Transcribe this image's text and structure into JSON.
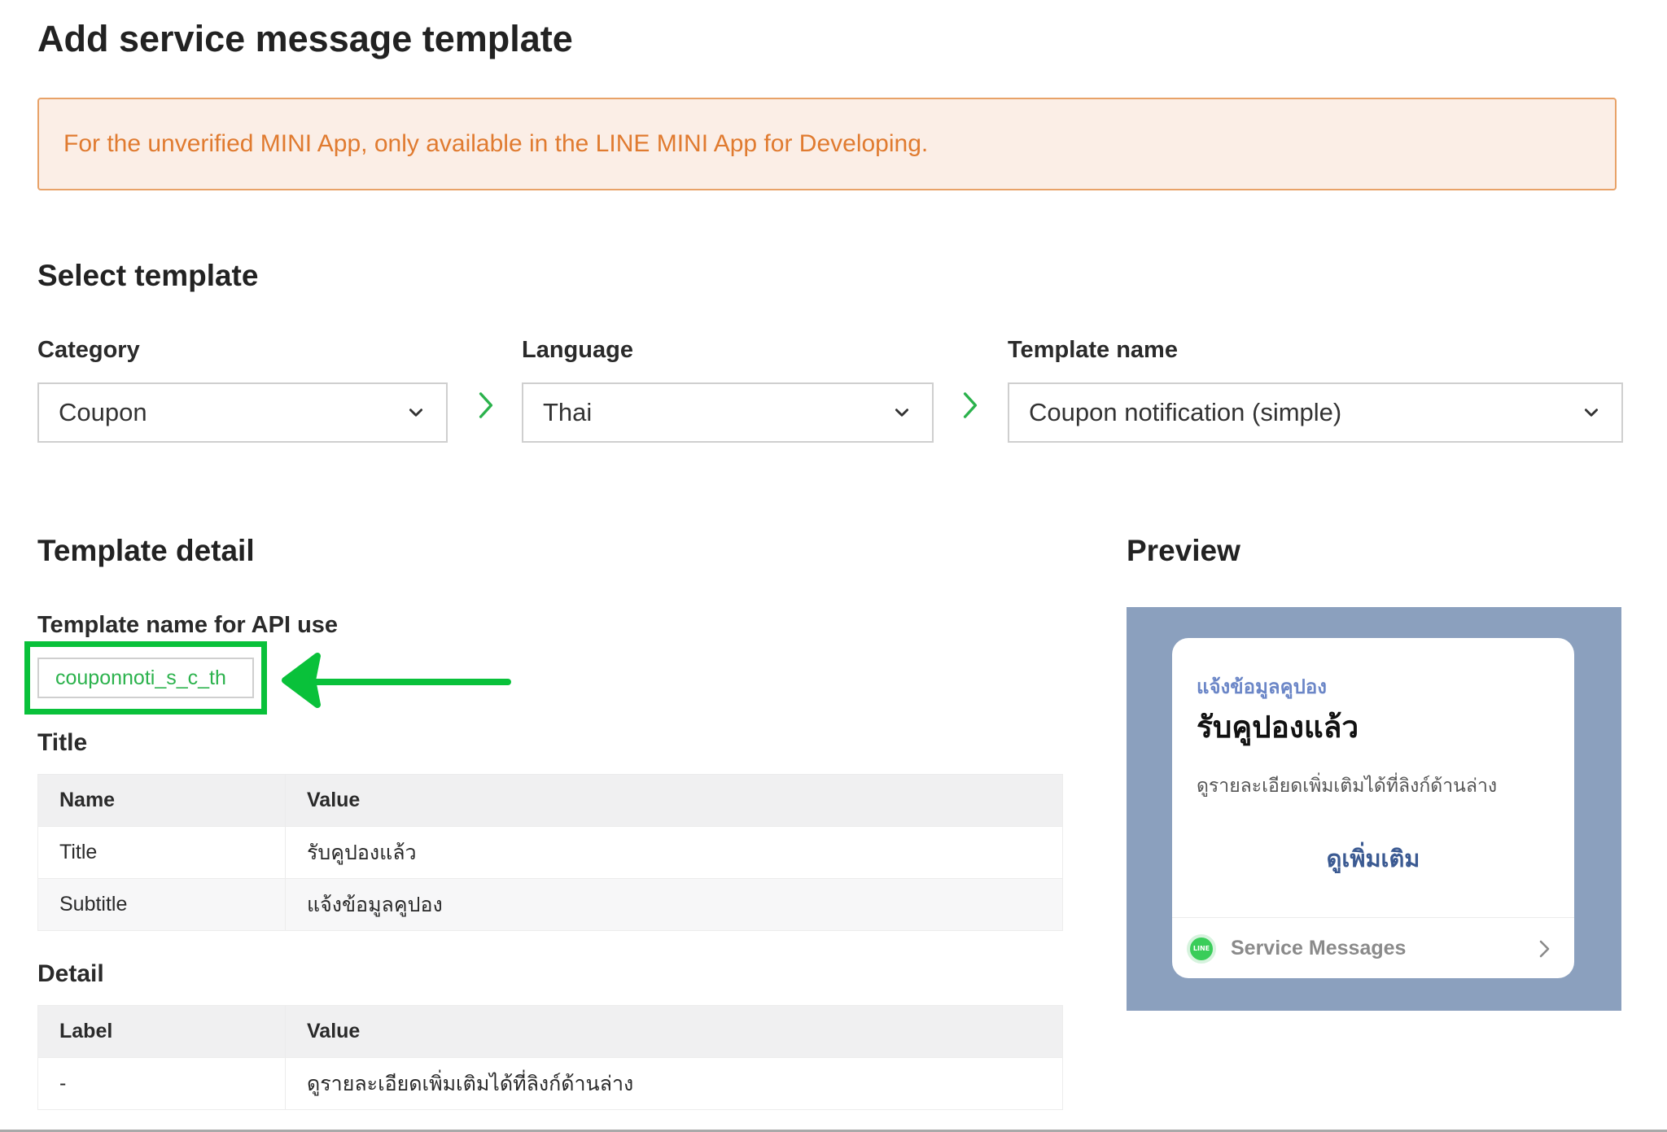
{
  "page": {
    "title": "Add service message template"
  },
  "alert": {
    "text": "For the unverified MINI App, only available in the LINE MINI App for Developing."
  },
  "select_template": {
    "heading": "Select template",
    "category": {
      "label": "Category",
      "value": "Coupon"
    },
    "language": {
      "label": "Language",
      "value": "Thai"
    },
    "template_name": {
      "label": "Template name",
      "value": "Coupon notification (simple)"
    }
  },
  "template_detail": {
    "heading": "Template detail",
    "api_name_label": "Template name for API use",
    "api_name_value": "couponnoti_s_c_th",
    "title_section": {
      "heading": "Title",
      "columns": [
        "Name",
        "Value"
      ],
      "rows": [
        [
          "Title",
          "รับคูปองแล้ว"
        ],
        [
          "Subtitle",
          "แจ้งข้อมูลคูปอง"
        ]
      ]
    },
    "detail_section": {
      "heading": "Detail",
      "columns": [
        "Label",
        "Value"
      ],
      "rows": [
        [
          "-",
          "ดูรายละเอียดเพิ่มเติมได้ที่ลิงก์ด้านล่าง"
        ]
      ]
    }
  },
  "preview": {
    "heading": "Preview",
    "subtitle": "แจ้งข้อมูลคูปอง",
    "title": "รับคูปองแล้ว",
    "detail": "ดูรายละเอียดเพิ่มเติมได้ที่ลิงก์ด้านล่าง",
    "button": "ดูเพิ่มเติม",
    "footer_label": "Service Messages",
    "footer_logo_text": "LINE"
  },
  "colors": {
    "alert_text": "#e07b30",
    "alert_bg": "#fbeee6",
    "accent_green": "#2bb24c",
    "highlight_green": "#09c13a",
    "preview_bg": "#8ba0be"
  },
  "icons": [
    "chevron-down-icon",
    "chevron-right-icon",
    "arrow-left-icon",
    "line-logo-icon"
  ]
}
